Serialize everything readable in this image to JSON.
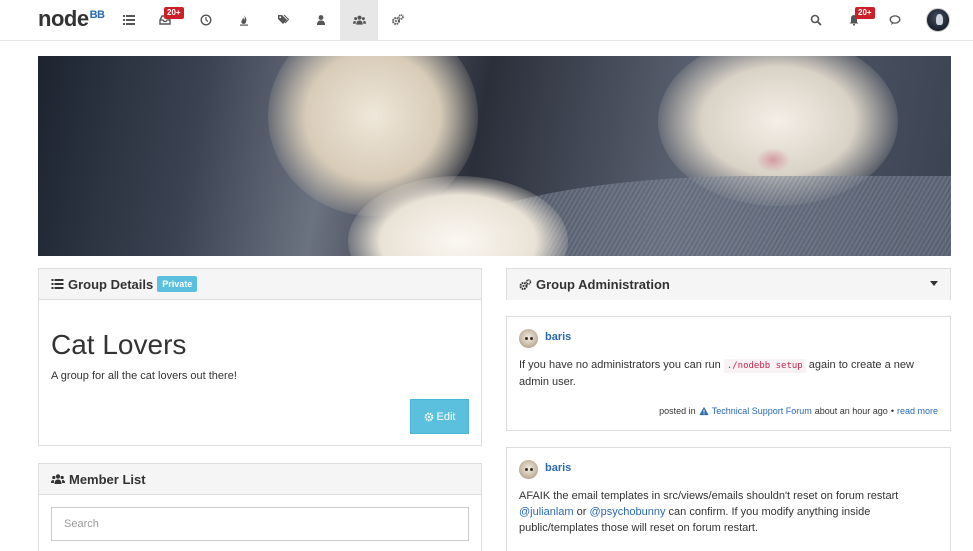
{
  "brand": {
    "logo_text": "node",
    "logo_suffix": "BB"
  },
  "nav": {
    "items": [
      {
        "name": "categories",
        "icon": "list-icon"
      },
      {
        "name": "unread",
        "icon": "inbox-icon",
        "badge": "20+"
      },
      {
        "name": "recent",
        "icon": "clock-icon"
      },
      {
        "name": "popular",
        "icon": "fire-icon"
      },
      {
        "name": "tags",
        "icon": "tags-icon"
      },
      {
        "name": "users",
        "icon": "user-icon"
      },
      {
        "name": "groups",
        "icon": "users-icon",
        "active": true
      },
      {
        "name": "admin",
        "icon": "cogs-icon"
      }
    ],
    "notifications_badge": "20+"
  },
  "group_details": {
    "heading": "Group Details",
    "label": "Private",
    "title": "Cat Lovers",
    "description": "A group for all the cat lovers out there!",
    "edit_label": "Edit"
  },
  "member_list": {
    "heading": "Member List",
    "search_placeholder": "Search"
  },
  "group_admin": {
    "heading": "Group Administration"
  },
  "posts": [
    {
      "user": "baris",
      "text_before": "If you have no administrators you can run ",
      "code": "./nodebb setup",
      "text_after": " again to create a new admin user.",
      "meta_prefix": "posted in",
      "category": "Technical Support Forum",
      "time": "about an hour ago",
      "separator": "•",
      "read_more": "read more"
    },
    {
      "user": "baris",
      "text_1": "AFAIK the email templates in src/views/emails shouldn't reset on forum restart ",
      "mention_1": "@julianlam",
      "text_2": " or ",
      "mention_2": "@psychobunny",
      "text_3": " can confirm. If you modify anything inside public/templates those will reset on forum restart."
    }
  ],
  "colors": {
    "accent": "#5bc0de",
    "link": "#2a6ab1",
    "badge": "#cb2027"
  }
}
